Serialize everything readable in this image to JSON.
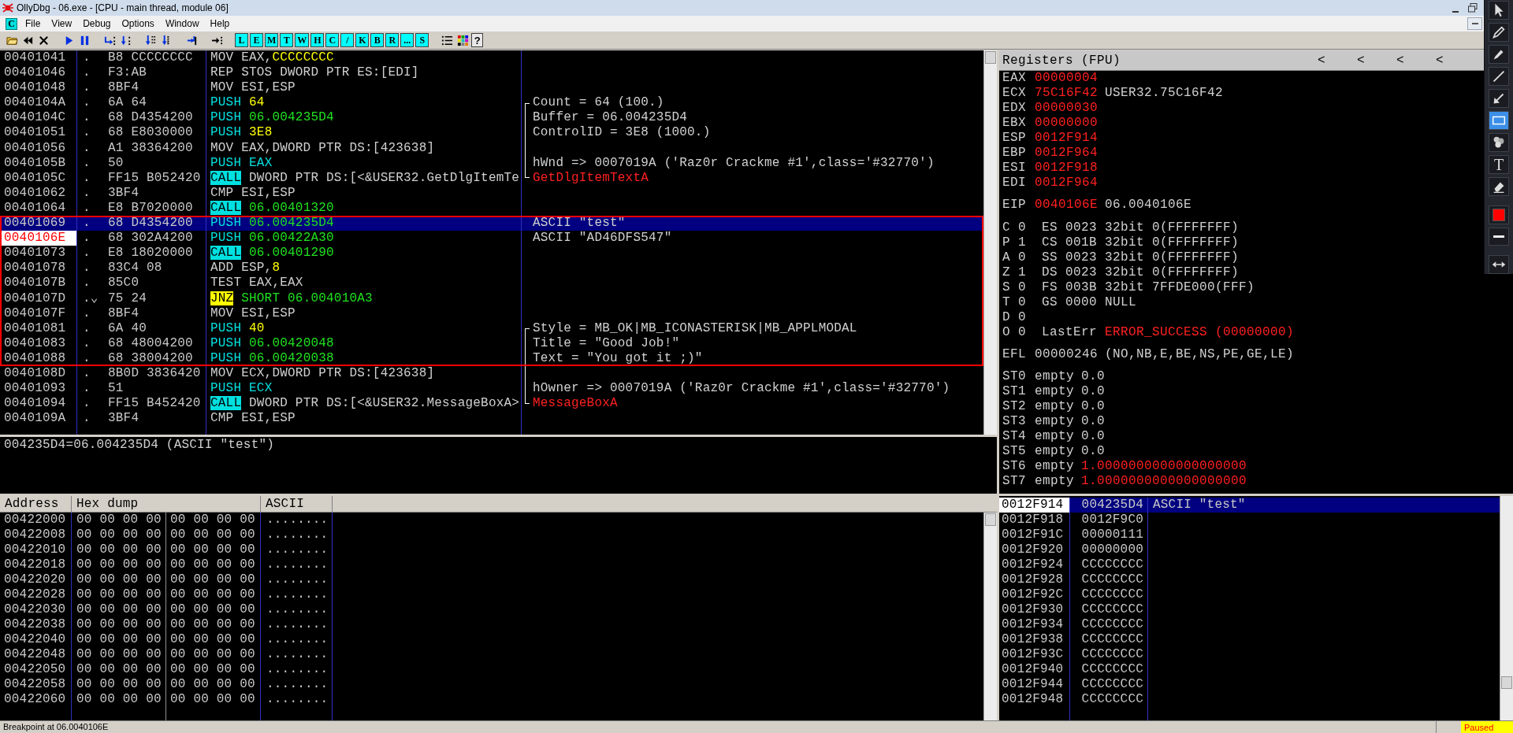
{
  "window": {
    "title": "OllyDbg - 06.exe - [CPU - main thread, module 06]"
  },
  "menu": {
    "window_icon": "C",
    "items": [
      "File",
      "View",
      "Debug",
      "Options",
      "Window",
      "Help"
    ]
  },
  "toolbar": [
    {
      "kind": "open"
    },
    {
      "kind": "rewind"
    },
    {
      "kind": "close"
    },
    {
      "kind": "run"
    },
    {
      "kind": "pause"
    },
    {
      "kind": "step_into"
    },
    {
      "kind": "step_over"
    },
    {
      "kind": "trace_into"
    },
    {
      "kind": "trace_over"
    },
    {
      "kind": "till_return"
    },
    {
      "kind": "goto"
    },
    {
      "kind": "letter",
      "label": "L"
    },
    {
      "kind": "letter",
      "label": "E"
    },
    {
      "kind": "letter",
      "label": "M"
    },
    {
      "kind": "letter",
      "label": "T"
    },
    {
      "kind": "letter",
      "label": "W"
    },
    {
      "kind": "letter",
      "label": "H"
    },
    {
      "kind": "letter",
      "label": "C"
    },
    {
      "kind": "letter",
      "label": "/"
    },
    {
      "kind": "letter",
      "label": "K"
    },
    {
      "kind": "letter",
      "label": "B"
    },
    {
      "kind": "letter",
      "label": "R"
    },
    {
      "kind": "letter",
      "label": "..."
    },
    {
      "kind": "letter",
      "label": "S"
    },
    {
      "kind": "list"
    },
    {
      "kind": "colors"
    },
    {
      "kind": "help",
      "label": "?"
    }
  ],
  "disasm": {
    "rows": [
      {
        "address": "00401041",
        "marker": ".",
        "hex": "B8 CCCCCCCC",
        "instruction": [
          {
            "text": "MOV EAX,",
            "kind": "op"
          },
          {
            "text": "CCCCCCCC",
            "kind": "const",
            "attach": true
          }
        ]
      },
      {
        "address": "00401046",
        "marker": ".",
        "hex": "F3:AB",
        "instruction": [
          {
            "text": "REP STOS DWORD PTR ES:[EDI]",
            "kind": "op"
          }
        ]
      },
      {
        "address": "00401048",
        "marker": ".",
        "hex": "8BF4",
        "instruction": [
          {
            "text": "MOV ESI,ESP",
            "kind": "op"
          }
        ]
      },
      {
        "address": "0040104A",
        "marker": ".",
        "hex": "6A 64",
        "instruction": [
          {
            "text": "PUSH",
            "kind": "push"
          },
          {
            "text": "64",
            "kind": "const"
          }
        ],
        "in_bracket": true,
        "bracket_open": true,
        "comment": "Count = 64 (100.)",
        "api": false
      },
      {
        "address": "0040104C",
        "marker": ".",
        "hex": "68 D4354200",
        "instruction": [
          {
            "text": "PUSH",
            "kind": "push"
          },
          {
            "text": "06.004235D4",
            "kind": "addr"
          }
        ],
        "in_bracket": true,
        "comment": "Buffer = 06.004235D4",
        "api": false
      },
      {
        "address": "00401051",
        "marker": ".",
        "hex": "68 E8030000",
        "instruction": [
          {
            "text": "PUSH",
            "kind": "push"
          },
          {
            "text": "3E8",
            "kind": "const"
          }
        ],
        "in_bracket": true,
        "comment": "ControlID = 3E8 (1000.)",
        "api": false
      },
      {
        "address": "00401056",
        "marker": ".",
        "hex": "A1 38364200",
        "instruction": [
          {
            "text": "MOV EAX,DWORD PTR DS:[423638]",
            "kind": "op"
          }
        ],
        "in_bracket": true
      },
      {
        "address": "0040105B",
        "marker": ".",
        "hex": "50",
        "instruction": [
          {
            "text": "PUSH",
            "kind": "push"
          },
          {
            "text": "EAX",
            "kind": "push"
          }
        ],
        "in_bracket": true,
        "comment": "hWnd => 0007019A ('Raz0r Crackme #1',class='#32770')",
        "api": false
      },
      {
        "address": "0040105C",
        "marker": ".",
        "hex": "FF15 B052420",
        "instruction": [
          {
            "text": "CALL",
            "kind": "call"
          },
          {
            "text": "DWORD PTR DS:[<&USER32.GetDlgItemTe",
            "kind": "op"
          }
        ],
        "in_bracket": true,
        "bracket_close": true,
        "comment": "GetDlgItemTextA",
        "api": true
      },
      {
        "address": "00401062",
        "marker": ".",
        "hex": "3BF4",
        "instruction": [
          {
            "text": "CMP ESI,ESP",
            "kind": "op"
          }
        ]
      },
      {
        "address": "00401064",
        "marker": ".",
        "hex": "E8 B7020000",
        "instruction": [
          {
            "text": "CALL",
            "kind": "call"
          },
          {
            "text": "06.00401320",
            "kind": "addr"
          }
        ]
      },
      {
        "address": "00401069",
        "marker": ".",
        "hex": "68 D4354200",
        "instruction": [
          {
            "text": "PUSH",
            "kind": "push"
          },
          {
            "text": "06.004235D4",
            "kind": "addr"
          }
        ],
        "comment": "ASCII \"test\"",
        "api": false,
        "selected": true,
        "boxed": true
      },
      {
        "address": "0040106E",
        "marker": ".",
        "hex": "68 302A4200",
        "instruction": [
          {
            "text": "PUSH",
            "kind": "push"
          },
          {
            "text": "06.00422A30",
            "kind": "addr"
          }
        ],
        "comment": "ASCII \"AD46DFS547\"",
        "api": false,
        "current": true,
        "boxed": true
      },
      {
        "address": "00401073",
        "marker": ".",
        "hex": "E8 18020000",
        "instruction": [
          {
            "text": "CALL",
            "kind": "call"
          },
          {
            "text": "06.00401290",
            "kind": "addr"
          }
        ],
        "boxed": true
      },
      {
        "address": "00401078",
        "marker": ".",
        "hex": "83C4 08",
        "instruction": [
          {
            "text": "ADD ESP,",
            "kind": "op"
          },
          {
            "text": "8",
            "kind": "const",
            "attach": true
          }
        ],
        "boxed": true
      },
      {
        "address": "0040107B",
        "marker": ".",
        "hex": "85C0",
        "instruction": [
          {
            "text": "TEST EAX,EAX",
            "kind": "op"
          }
        ],
        "boxed": true
      },
      {
        "address": "0040107D",
        "marker": ".⌄",
        "hex": "75 24",
        "instruction": [
          {
            "text": "JNZ",
            "kind": "jcc"
          },
          {
            "text": "SHORT 06.004010A3",
            "kind": "addr"
          }
        ],
        "boxed": true
      },
      {
        "address": "0040107F",
        "marker": ".",
        "hex": "8BF4",
        "instruction": [
          {
            "text": "MOV ESI,ESP",
            "kind": "op"
          }
        ],
        "boxed": true
      },
      {
        "address": "00401081",
        "marker": ".",
        "hex": "6A 40",
        "instruction": [
          {
            "text": "PUSH",
            "kind": "push"
          },
          {
            "text": "40",
            "kind": "const"
          }
        ],
        "in_bracket": true,
        "bracket_open": true,
        "comment": "Style = MB_OK|MB_ICONASTERISK|MB_APPLMODAL",
        "api": false,
        "boxed": true
      },
      {
        "address": "00401083",
        "marker": ".",
        "hex": "68 48004200",
        "instruction": [
          {
            "text": "PUSH",
            "kind": "push"
          },
          {
            "text": "06.00420048",
            "kind": "addr"
          }
        ],
        "in_bracket": true,
        "comment": "Title = \"Good Job!\"",
        "api": false,
        "boxed": true
      },
      {
        "address": "00401088",
        "marker": ".",
        "hex": "68 38004200",
        "instruction": [
          {
            "text": "PUSH",
            "kind": "push"
          },
          {
            "text": "06.00420038",
            "kind": "addr"
          }
        ],
        "in_bracket": true,
        "comment": "Text = \"You got it ;)\"",
        "api": false,
        "boxed": true
      },
      {
        "address": "0040108D",
        "marker": ".",
        "hex": "8B0D 3836420",
        "instruction": [
          {
            "text": "MOV ECX,DWORD PTR DS:[423638]",
            "kind": "op"
          }
        ],
        "in_bracket": true
      },
      {
        "address": "00401093",
        "marker": ".",
        "hex": "51",
        "instruction": [
          {
            "text": "PUSH",
            "kind": "push"
          },
          {
            "text": "ECX",
            "kind": "push"
          }
        ],
        "in_bracket": true,
        "comment": "hOwner => 0007019A ('Raz0r Crackme #1',class='#32770')",
        "api": false
      },
      {
        "address": "00401094",
        "marker": ".",
        "hex": "FF15 B452420",
        "instruction": [
          {
            "text": "CALL",
            "kind": "call"
          },
          {
            "text": "DWORD PTR DS:[<&USER32.MessageBoxA>",
            "kind": "op"
          }
        ],
        "in_bracket": true,
        "bracket_close": true,
        "comment": "MessageBoxA",
        "api": true
      },
      {
        "address": "0040109A",
        "marker": ".",
        "hex": "3BF4",
        "instruction": [
          {
            "text": "CMP ESI,ESP",
            "kind": "op"
          }
        ]
      }
    ],
    "info": "004235D4=06.004235D4 (ASCII \"test\")"
  },
  "registers": {
    "title": "Registers (FPU)",
    "scroll_arrows": [
      "<",
      "<",
      "<",
      "<"
    ],
    "general": [
      {
        "name": "EAX",
        "value": "00000004",
        "changed": true
      },
      {
        "name": "ECX",
        "value": "75C16F42",
        "changed": true,
        "comment": "USER32.75C16F42"
      },
      {
        "name": "EDX",
        "value": "00000030",
        "changed": true
      },
      {
        "name": "EBX",
        "value": "00000000",
        "changed": true
      },
      {
        "name": "ESP",
        "value": "0012F914",
        "changed": true
      },
      {
        "name": "EBP",
        "value": "0012F964",
        "changed": true
      },
      {
        "name": "ESI",
        "value": "0012F918",
        "changed": true
      },
      {
        "name": "EDI",
        "value": "0012F964",
        "changed": true
      }
    ],
    "eip": {
      "name": "EIP",
      "value": "0040106E",
      "changed": true,
      "comment": "06.0040106E"
    },
    "flags": [
      {
        "flag": "C",
        "bit": "0",
        "detail": "ES 0023 32bit 0(FFFFFFFF)"
      },
      {
        "flag": "P",
        "bit": "1",
        "detail": "CS 001B 32bit 0(FFFFFFFF)"
      },
      {
        "flag": "A",
        "bit": "0",
        "detail": "SS 0023 32bit 0(FFFFFFFF)"
      },
      {
        "flag": "Z",
        "bit": "1",
        "detail": "DS 0023 32bit 0(FFFFFFFF)"
      },
      {
        "flag": "S",
        "bit": "0",
        "detail": "FS 003B 32bit 7FFDE000(FFF)"
      },
      {
        "flag": "T",
        "bit": "0",
        "detail": "GS 0000 NULL"
      },
      {
        "flag": "D",
        "bit": "0"
      },
      {
        "flag": "O",
        "bit": "0",
        "detail": "LastErr",
        "value": "ERROR_SUCCESS (00000000)",
        "changed": true
      }
    ],
    "efl": {
      "name": "EFL",
      "value": "00000246",
      "changed": false,
      "comment": "(NO,NB,E,BE,NS,PE,GE,LE)"
    },
    "fpu": [
      {
        "name": "ST0",
        "tag": "empty",
        "value": "0.0",
        "changed": false
      },
      {
        "name": "ST1",
        "tag": "empty",
        "value": "0.0",
        "changed": false
      },
      {
        "name": "ST2",
        "tag": "empty",
        "value": "0.0",
        "changed": false
      },
      {
        "name": "ST3",
        "tag": "empty",
        "value": "0.0",
        "changed": false
      },
      {
        "name": "ST4",
        "tag": "empty",
        "value": "0.0",
        "changed": false
      },
      {
        "name": "ST5",
        "tag": "empty",
        "value": "0.0",
        "changed": false
      },
      {
        "name": "ST6",
        "tag": "empty",
        "value": "1.0000000000000000000",
        "changed": true
      },
      {
        "name": "ST7",
        "tag": "empty",
        "value": "1.0000000000000000000",
        "changed": true
      }
    ]
  },
  "dump": {
    "columns": [
      "Address",
      "Hex dump",
      "ASCII"
    ],
    "rows": [
      {
        "address": "00422000",
        "hex_1": "00 00 00 00",
        "hex_2": "00 00 00 00",
        "ascii": "........"
      },
      {
        "address": "00422008",
        "hex_1": "00 00 00 00",
        "hex_2": "00 00 00 00",
        "ascii": "........"
      },
      {
        "address": "00422010",
        "hex_1": "00 00 00 00",
        "hex_2": "00 00 00 00",
        "ascii": "........"
      },
      {
        "address": "00422018",
        "hex_1": "00 00 00 00",
        "hex_2": "00 00 00 00",
        "ascii": "........"
      },
      {
        "address": "00422020",
        "hex_1": "00 00 00 00",
        "hex_2": "00 00 00 00",
        "ascii": "........"
      },
      {
        "address": "00422028",
        "hex_1": "00 00 00 00",
        "hex_2": "00 00 00 00",
        "ascii": "........"
      },
      {
        "address": "00422030",
        "hex_1": "00 00 00 00",
        "hex_2": "00 00 00 00",
        "ascii": "........"
      },
      {
        "address": "00422038",
        "hex_1": "00 00 00 00",
        "hex_2": "00 00 00 00",
        "ascii": "........"
      },
      {
        "address": "00422040",
        "hex_1": "00 00 00 00",
        "hex_2": "00 00 00 00",
        "ascii": "........"
      },
      {
        "address": "00422048",
        "hex_1": "00 00 00 00",
        "hex_2": "00 00 00 00",
        "ascii": "........"
      },
      {
        "address": "00422050",
        "hex_1": "00 00 00 00",
        "hex_2": "00 00 00 00",
        "ascii": "........"
      },
      {
        "address": "00422058",
        "hex_1": "00 00 00 00",
        "hex_2": "00 00 00 00",
        "ascii": "........"
      },
      {
        "address": "00422060",
        "hex_1": "00 00 00 00",
        "hex_2": "00 00 00 00",
        "ascii": "........"
      }
    ]
  },
  "stack": {
    "rows": [
      {
        "address": "0012F914",
        "value": "004235D4",
        "comment": "ASCII \"test\"",
        "selected": true
      },
      {
        "address": "0012F918",
        "value": "0012F9C0",
        "selected": false
      },
      {
        "address": "0012F91C",
        "value": "00000111",
        "selected": false
      },
      {
        "address": "0012F920",
        "value": "00000000",
        "selected": false
      },
      {
        "address": "0012F924",
        "value": "CCCCCCCC",
        "selected": false
      },
      {
        "address": "0012F928",
        "value": "CCCCCCCC",
        "selected": false
      },
      {
        "address": "0012F92C",
        "value": "CCCCCCCC",
        "selected": false
      },
      {
        "address": "0012F930",
        "value": "CCCCCCCC",
        "selected": false
      },
      {
        "address": "0012F934",
        "value": "CCCCCCCC",
        "selected": false
      },
      {
        "address": "0012F938",
        "value": "CCCCCCCC",
        "selected": false
      },
      {
        "address": "0012F93C",
        "value": "CCCCCCCC",
        "selected": false
      },
      {
        "address": "0012F940",
        "value": "CCCCCCCC",
        "selected": false
      },
      {
        "address": "0012F944",
        "value": "CCCCCCCC",
        "selected": false
      },
      {
        "address": "0012F948",
        "value": "CCCCCCCC",
        "selected": false
      }
    ]
  },
  "status_bar": {
    "message": "Breakpoint at 06.0040106E",
    "state": "Paused"
  },
  "annotation_tools": [
    {
      "kind": "pointer",
      "selected": false
    },
    {
      "kind": "pencil",
      "selected": false
    },
    {
      "kind": "marker",
      "selected": false
    },
    {
      "kind": "line",
      "selected": false
    },
    {
      "kind": "arrow",
      "selected": false
    },
    {
      "kind": "rectangle",
      "selected": true
    },
    {
      "kind": "numbering",
      "selected": false
    },
    {
      "kind": "text",
      "label": "T",
      "selected": false
    },
    {
      "kind": "eraser",
      "selected": false
    },
    {
      "kind": "color",
      "color": "#ff0000",
      "selected": false
    },
    {
      "kind": "stroke",
      "selected": false
    },
    {
      "kind": "expand",
      "selected": false
    }
  ]
}
